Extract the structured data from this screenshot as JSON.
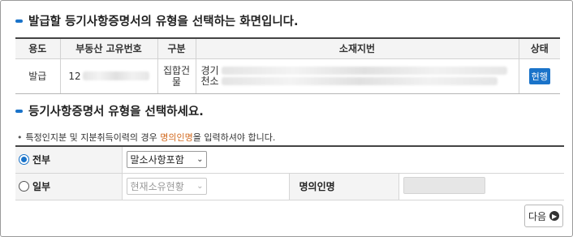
{
  "titles": {
    "main": "발급할 등기사항증명서의 유형을 선택하는 화면입니다.",
    "select": "등기사항증명서 유형을 선택하세요."
  },
  "info_table": {
    "headers": [
      "용도",
      "부동산 고유번호",
      "구분",
      "소재지번",
      "상태"
    ],
    "row": {
      "purpose": "발급",
      "reg_no_prefix": "12",
      "type_line1": "집합건",
      "type_line2": "물",
      "loc_line1_prefix": "경기",
      "loc_line2_prefix": "천소",
      "status": "현행"
    }
  },
  "notice": {
    "bullet": "•",
    "text_before": "특정인지분 및 지분취득이력의 경우 ",
    "highlight": "명의인명",
    "text_after": "을 입력하셔야 합니다."
  },
  "form": {
    "all_label": "전부",
    "all_selected": true,
    "all_option": "말소사항포함",
    "partial_label": "일부",
    "partial_selected": false,
    "partial_option": "현재소유현황",
    "name_label": "명의인명",
    "name_value": ""
  },
  "buttons": {
    "next": "다음"
  },
  "colors": {
    "accent": "#1a73c9",
    "highlight": "#d2691e"
  }
}
